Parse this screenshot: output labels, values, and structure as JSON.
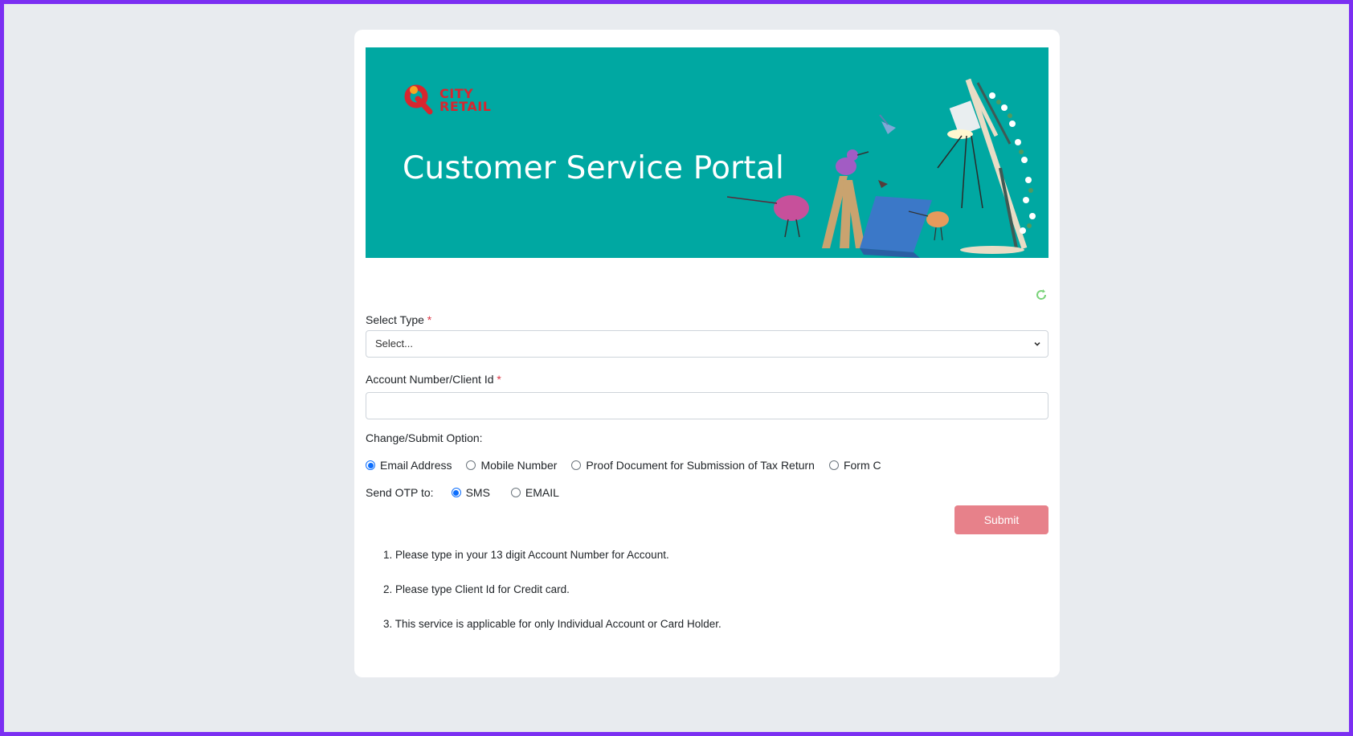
{
  "banner": {
    "logo_line1": "CITY",
    "logo_line2": "RETAIL",
    "title": "Customer Service Portal"
  },
  "form": {
    "select_type": {
      "label": "Select Type",
      "required_mark": "*",
      "value": "Select..."
    },
    "account": {
      "label": "Account Number/Client Id",
      "required_mark": "*",
      "value": ""
    },
    "change_option": {
      "label": "Change/Submit Option:",
      "options": [
        {
          "label": "Email Address",
          "checked": true
        },
        {
          "label": "Mobile Number",
          "checked": false
        },
        {
          "label": "Proof Document for Submission of Tax Return",
          "checked": false
        },
        {
          "label": "Form C",
          "checked": false
        }
      ]
    },
    "otp": {
      "label": "Send OTP to:",
      "options": [
        {
          "label": "SMS",
          "checked": true
        },
        {
          "label": "EMAIL",
          "checked": false
        }
      ]
    },
    "submit_label": "Submit"
  },
  "notes": [
    "1. Please type in your 13 digit Account Number for Account.",
    "2. Please type Client Id for Credit card.",
    "3. This service is applicable for only Individual Account or Card Holder."
  ],
  "colors": {
    "banner_bg": "#00a8a2",
    "submit_bg": "#e7818a",
    "radio_accent": "#0d6efd",
    "required": "#dc3545"
  }
}
